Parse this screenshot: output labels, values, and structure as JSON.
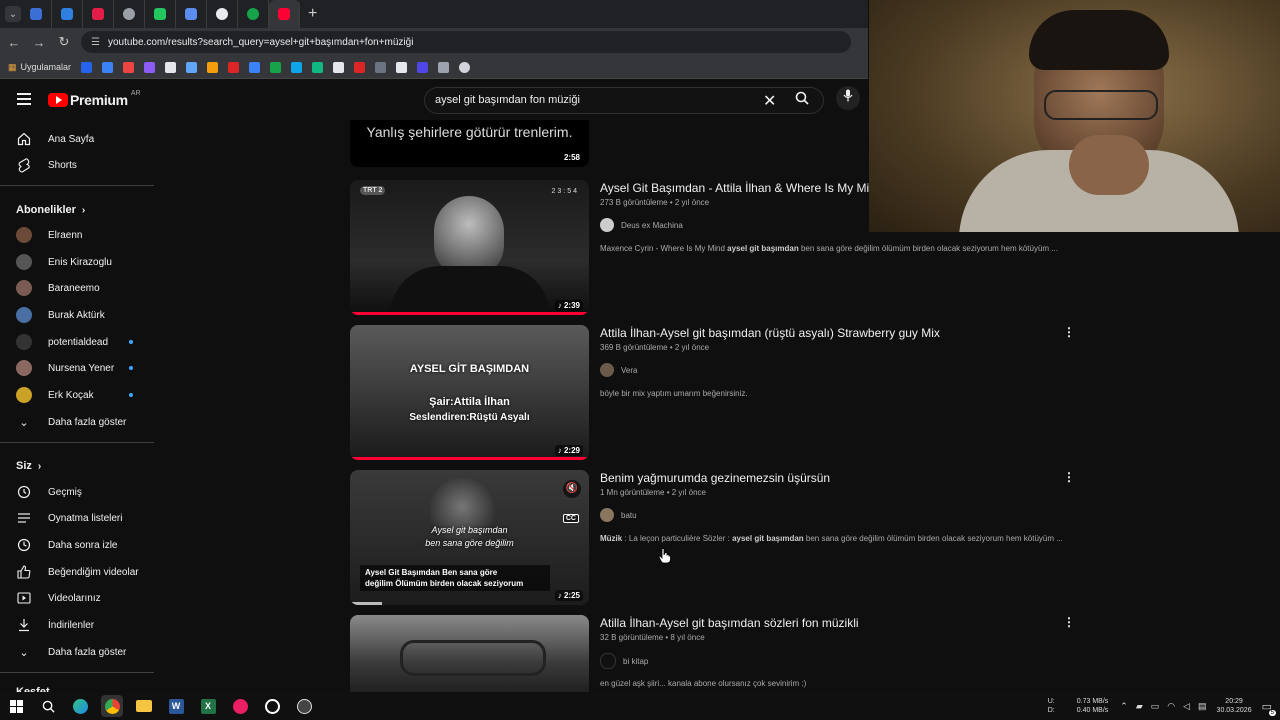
{
  "browser": {
    "url": "youtube.com/results?search_query=aysel+git+başımdan+fon+müziği",
    "bookmarks_label": "Uygulamalar"
  },
  "header": {
    "logo_text": "Premium",
    "logo_country": "AR",
    "search_query": "aysel git başımdan fon müziği"
  },
  "sidebar": {
    "nav": [
      {
        "label": "Ana Sayfa"
      },
      {
        "label": "Shorts"
      }
    ],
    "subscriptions_title": "Abonelikler",
    "subscriptions": [
      {
        "label": "Elraenn"
      },
      {
        "label": "Enis Kirazoglu"
      },
      {
        "label": "Baraneemo"
      },
      {
        "label": "Burak Aktürk"
      },
      {
        "label": "potentialdead"
      },
      {
        "label": "Nursena Yener"
      },
      {
        "label": "Erk Koçak"
      },
      {
        "label": "Daha fazla göster"
      }
    ],
    "you_title": "Siz",
    "you": [
      {
        "label": "Geçmiş"
      },
      {
        "label": "Oynatma listeleri"
      },
      {
        "label": "Daha sonra izle"
      },
      {
        "label": "Beğendiğim videolar"
      },
      {
        "label": "Videolarınız"
      },
      {
        "label": "İndirilenler"
      },
      {
        "label": "Daha fazla göster"
      }
    ],
    "explore_title": "Keşfet"
  },
  "results": [
    {
      "title": "Yanlış şehirlere götürür trenlerim.",
      "duration": "2:58"
    },
    {
      "title": "Aysel Git Başımdan - Attila İlhan & Where Is My Mind",
      "views": "273 B görüntüleme",
      "age": "2 yıl önce",
      "channel": "Deus ex Machina",
      "desc_pre": "Maxence Cyrin - Where Is My Mind ",
      "desc_bold": "aysel git başımdan",
      "desc_post": " ben sana göre değilim ölümüm birden olacak seziyorum hem kötüyüm ...",
      "duration": "2:39",
      "thumb_badge": "TRT 2",
      "thumb_clock": "23:54"
    },
    {
      "title": "Attila İlhan-Aysel git başımdan (rüştü asyalı) Strawberry guy Mix",
      "views": "369 B görüntüleme",
      "age": "2 yıl önce",
      "channel": "Vera",
      "desc": "böyle bir mix yaptım umarım beğenirsiniz.",
      "duration": "2:29",
      "thumb_line1": "AYSEL GİT BAŞIMDAN",
      "thumb_line2": "Şair:Attila İlhan",
      "thumb_line3": "Seslendiren:Rüştü Asyalı"
    },
    {
      "title": "Benim yağmurumda gezinemezsin üşürsün",
      "views": "1 Mn görüntüleme",
      "age": "2 yıl önce",
      "channel": "batu",
      "desc_label": "Müzik",
      "desc_pre": " : La leçon particulière Sözler : ",
      "desc_bold": "aysel git başımdan",
      "desc_post": " ben sana göre değilim ölümüm birden olacak seziyorum hem kötüyüm ...",
      "duration": "2:25",
      "thumb_line1": "Aysel git başımdan",
      "thumb_line2": "ben sana göre değilim",
      "thumb_caption1": "Aysel Git Başımdan Ben sana göre",
      "thumb_caption2": "değilim Ölümüm birden olacak seziyorum",
      "cc_label": "CC"
    },
    {
      "title": "Atilla İlhan-Aysel git başımdan sözleri fon müzikli",
      "views": "32 B görüntüleme",
      "age": "8 yıl önce",
      "channel": "bi kitap",
      "desc": "en güzel aşk şiiri... kanala abone olursanız çok sevinirim :)"
    }
  ],
  "taskbar": {
    "net_up": "0.73 MB/s",
    "net_down": "0.40 MB/s",
    "net_u_label": "U:",
    "net_d_label": "D:",
    "time": "20:29",
    "date": "30.03.2026",
    "notif": "5"
  }
}
